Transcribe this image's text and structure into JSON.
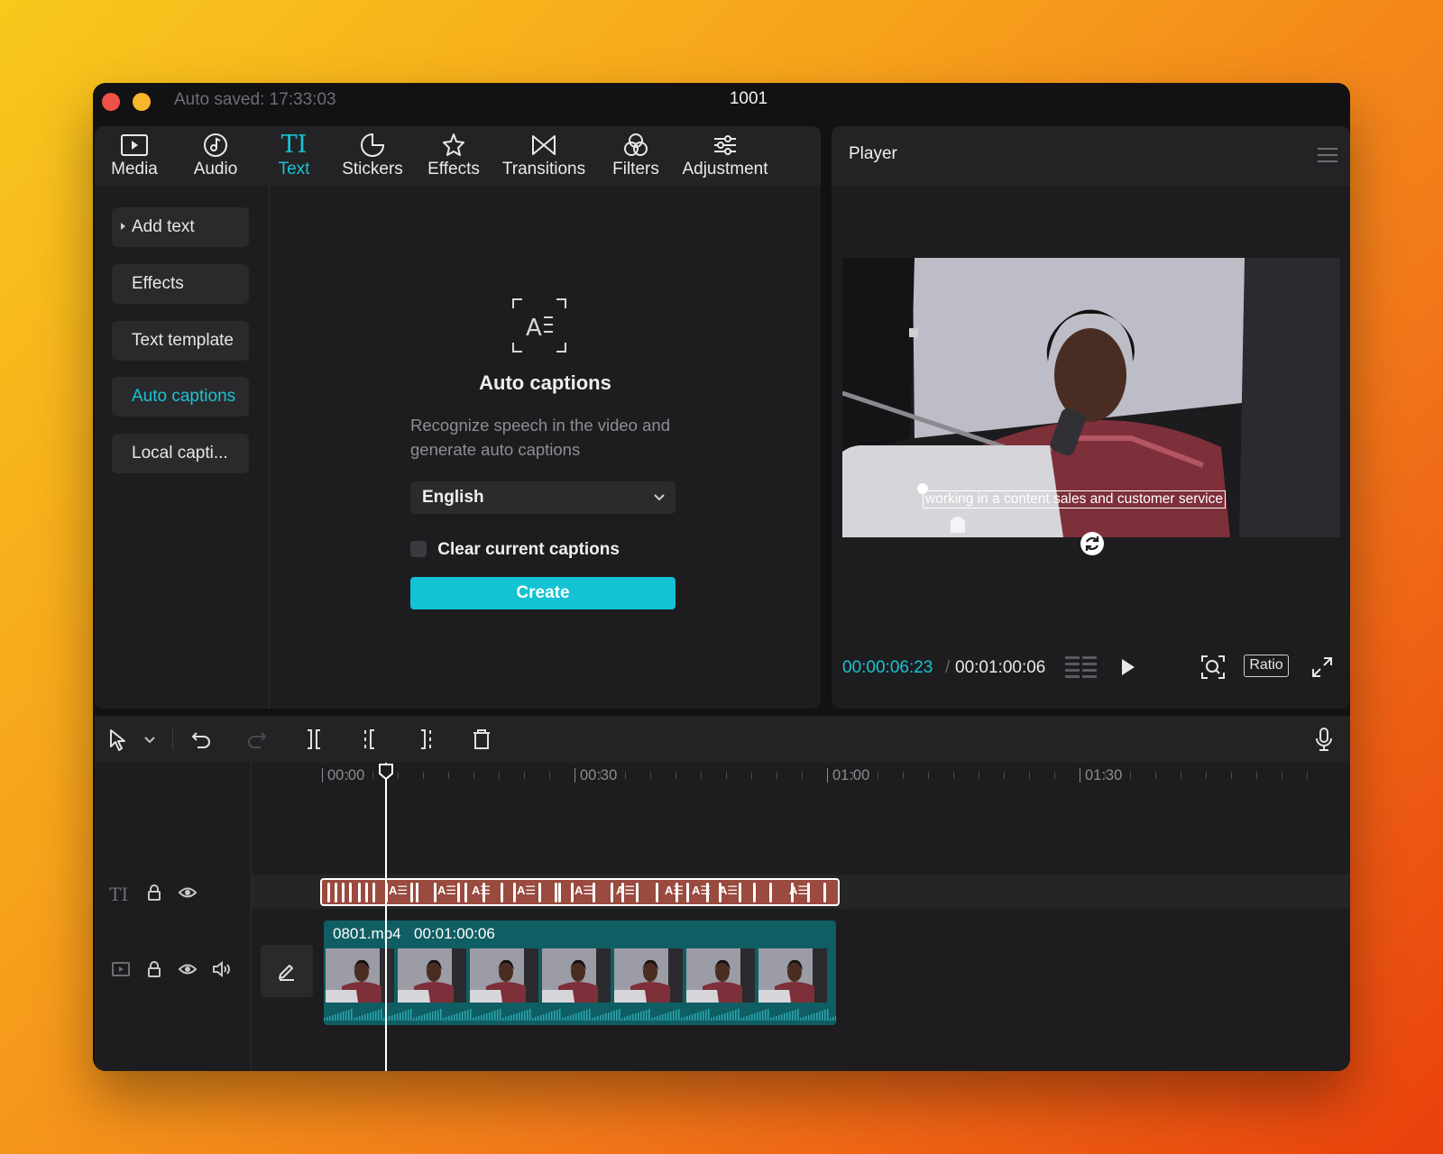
{
  "window": {
    "autosave": "Auto saved: 17:33:03",
    "title": "1001"
  },
  "tabs": [
    {
      "label": "Media",
      "icon": "media-icon"
    },
    {
      "label": "Audio",
      "icon": "audio-icon"
    },
    {
      "label": "Text",
      "icon": "text-icon",
      "active": true
    },
    {
      "label": "Stickers",
      "icon": "stickers-icon"
    },
    {
      "label": "Effects",
      "icon": "effects-icon"
    },
    {
      "label": "Transitions",
      "icon": "transitions-icon"
    },
    {
      "label": "Filters",
      "icon": "filters-icon"
    },
    {
      "label": "Adjustment",
      "icon": "adjustment-icon"
    }
  ],
  "sidebar": {
    "items": [
      {
        "label": "Add text"
      },
      {
        "label": "Effects"
      },
      {
        "label": "Text template"
      },
      {
        "label": "Auto captions",
        "active": true
      },
      {
        "label": "Local capti..."
      }
    ]
  },
  "autocaptions": {
    "title": "Auto captions",
    "description": "Recognize speech in the video and generate auto captions",
    "language": "English",
    "clear_label": "Clear current captions",
    "create_label": "Create"
  },
  "player": {
    "title": "Player",
    "caption_text": "working in a content sales and customer service",
    "current_time": "00:00:06:23",
    "total_time": "00:01:00:06",
    "ratio_label": "Ratio"
  },
  "timeline": {
    "ruler": [
      "00:00",
      "00:30",
      "01:00",
      "01:30"
    ],
    "text_track_icon": "TI",
    "video_clip": {
      "name": "0801.mp4",
      "duration": "00:01:00:06"
    },
    "caption_segment_label": "A☰"
  },
  "colors": {
    "accent": "#19c3d4",
    "text_clip": "#9a4a3f",
    "video_clip": "#0f5e63"
  }
}
